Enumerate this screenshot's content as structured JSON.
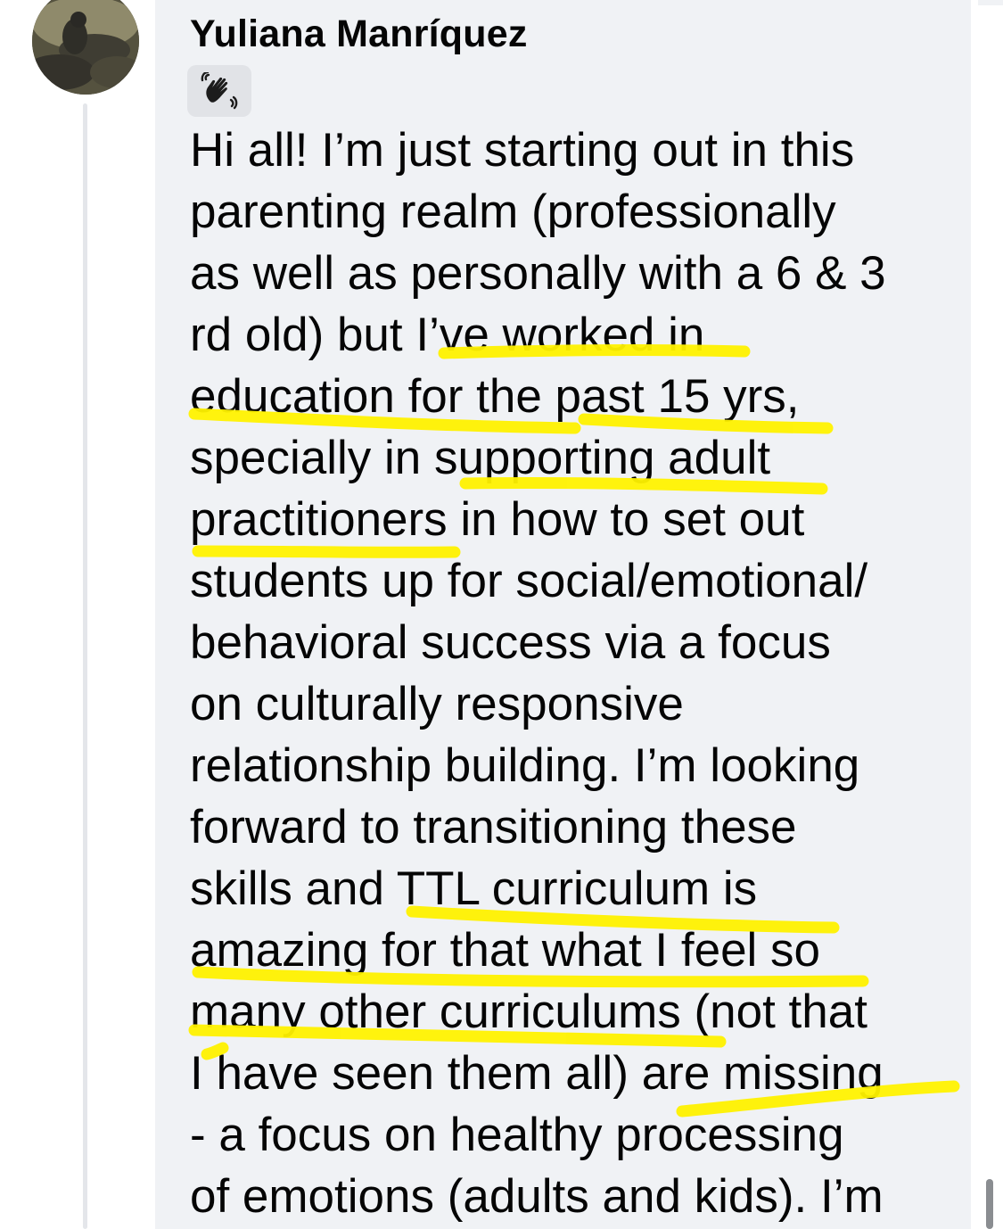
{
  "comment": {
    "author": "Yuliana Manríquez",
    "badge_icon": "waving-hand-icon",
    "lines": [
      "Hi all! I’m just starting out in this",
      "parenting realm (professionally",
      "as well as personally with a 6 & 3",
      "rd old) but I’ve worked in",
      "education for the past 15 yrs,",
      "specially in supporting adult",
      "practitioners in how to set out",
      "students up for social/emotional/",
      "behavioral success via a focus",
      "on culturally responsive",
      "relationship building. I’m looking",
      "forward to transitioning these",
      "skills and TTL curriculum is",
      "amazing for that what I feel so",
      "many other curriculums (not that",
      "I have seen them all) are missing",
      "- a focus on healthy processing",
      "of emotions (adults and kids). I’m"
    ]
  },
  "colors": {
    "bubble": "#f0f2f5",
    "text": "#050505",
    "highlight": "#fff200",
    "thread_line": "#e4e6ea"
  }
}
